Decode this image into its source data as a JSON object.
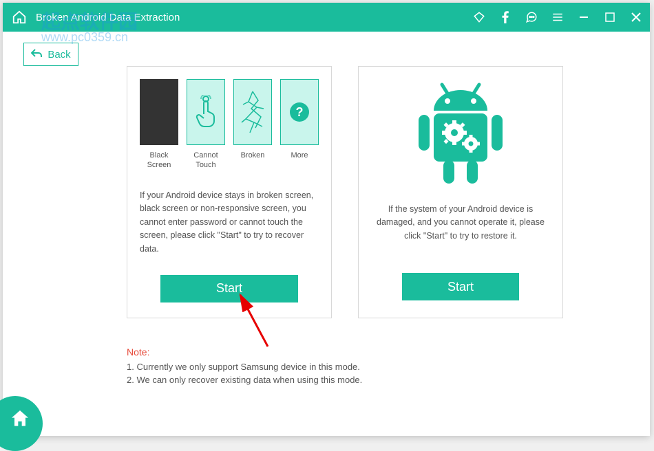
{
  "window": {
    "title": "Broken Android Data Extraction"
  },
  "back": {
    "label": "Back"
  },
  "left_panel": {
    "tiles": {
      "black": "Black Screen",
      "touch": "Cannot Touch",
      "broken": "Broken",
      "more": "More"
    },
    "description": "If your Android device stays in broken screen, black screen or non-responsive screen, you cannot enter password or cannot touch the screen, please click \"Start\" to try to recover data.",
    "start_label": "Start"
  },
  "right_panel": {
    "description": "If the system of your Android device is damaged, and you cannot operate it, please click \"Start\" to try to restore it.",
    "start_label": "Start"
  },
  "notes": {
    "title": "Note:",
    "line1": "1. Currently we only support Samsung device in this mode.",
    "line2": "2. We can only recover existing data when using this mode."
  },
  "watermark": {
    "cn": "起点软件园",
    "url": "www.pc0359.cn"
  },
  "colors": {
    "accent": "#1abc9c",
    "danger": "#e74c3c"
  }
}
